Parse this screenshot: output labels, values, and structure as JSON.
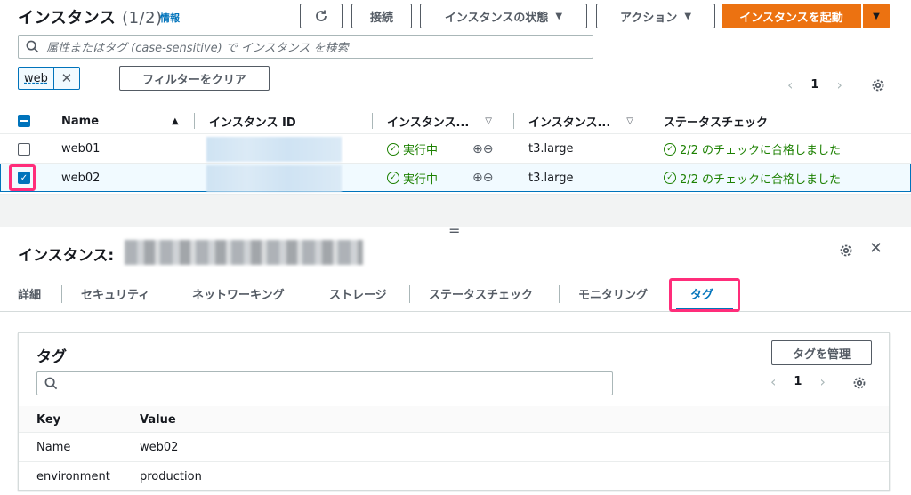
{
  "header": {
    "title": "インスタンス",
    "count": "(1/2)",
    "info": "情報"
  },
  "toolbar": {
    "connect": "接続",
    "instance_state": "インスタンスの状態",
    "actions": "アクション",
    "launch": "インスタンスを起動"
  },
  "filter": {
    "placeholder": "属性またはタグ (case-sensitive) で インスタンス を検索",
    "token": "web",
    "clear": "フィルターをクリア"
  },
  "pager": {
    "page": "1"
  },
  "table": {
    "columns": [
      "Name",
      "インスタンス ID",
      "インスタンス...",
      "インスタンス...",
      "ステータスチェック"
    ],
    "rows": [
      {
        "name": "web01",
        "state": "実行中",
        "type": "t3.large",
        "status": "2/2 のチェックに合格しました",
        "selected": false
      },
      {
        "name": "web02",
        "state": "実行中",
        "type": "t3.large",
        "status": "2/2 のチェックに合格しました",
        "selected": true
      }
    ]
  },
  "detail": {
    "title": "インスタンス:",
    "tabs": [
      "詳細",
      "セキュリティ",
      "ネットワーキング",
      "ストレージ",
      "ステータスチェック",
      "モニタリング",
      "タグ"
    ],
    "active_tab": "タグ"
  },
  "tags_panel": {
    "title": "タグ",
    "manage": "タグを管理",
    "page": "1",
    "columns": [
      "Key",
      "Value"
    ],
    "rows": [
      {
        "key": "Name",
        "value": "web02"
      },
      {
        "key": "environment",
        "value": "production"
      }
    ]
  },
  "colors": {
    "primary": "#ec7211",
    "link": "#0073bb",
    "success": "#1d8102",
    "highlight": "#ff2d7a"
  }
}
